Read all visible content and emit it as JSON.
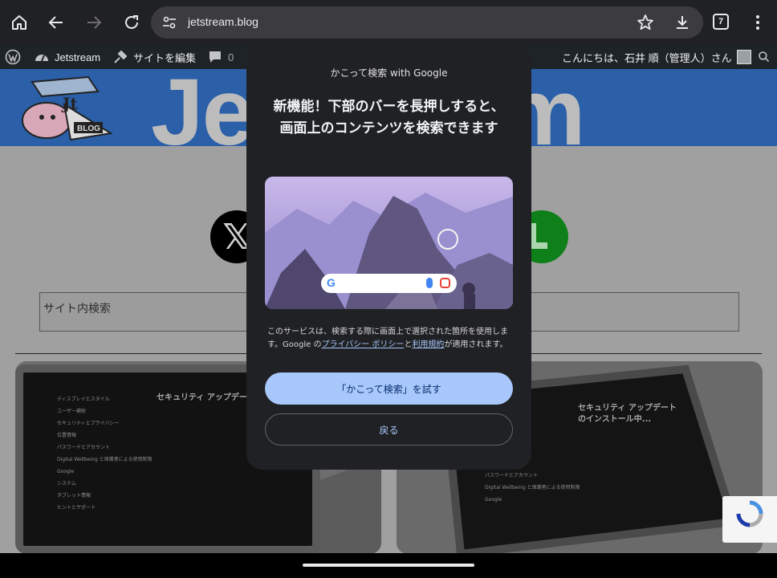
{
  "browser": {
    "url": "jetstream.blog",
    "tab_count": "7",
    "icons": [
      "home-icon",
      "back-icon",
      "forward-icon",
      "reload-icon",
      "site-settings-icon",
      "bookmark-star-icon",
      "download-icon",
      "tab-switcher-icon",
      "overflow-menu-icon"
    ]
  },
  "adminbar": {
    "site_name": "Jetstream",
    "edit_site": "サイトを編集",
    "comments_count": "0",
    "greeting": "こんにちは、石井 順（管理人）さん"
  },
  "page": {
    "banner_text": "Jetstream",
    "search_placeholder": "サイト内検索",
    "x_glyph": "𝕏"
  },
  "modal": {
    "header": "かこって検索 with Google",
    "title": "新機能！下部のバーを長押しすると、画面上のコンテンツを検索できます",
    "desc_prefix": "このサービスは、検索する際に画面上で選択された箇所を使用します。Google の",
    "privacy_link": "プライバシー ポリシー",
    "desc_middle": "と",
    "terms_link": "利用規約",
    "desc_suffix": "が適用されます。",
    "primary_button": "「かこって検索」を試す",
    "secondary_button": "戻る",
    "g_letter": "G"
  },
  "thumbs": {
    "left_heading": "セキュリティ アップデートのインストール中...",
    "left_menu": "ディスプレイとスタイル\nユーザー補助\nセキュリティとプライバシー\n位置情報\nパスワードとアカウント\nDigital Wellbeing と保護者による使用制限\nGoogle\nシステム\nタブレット情報\nヒントとサポート",
    "right_heading": "セキュリティ アップデートのインストール中...",
    "right_menu": "安全性と緊急情報\nパスワードとアカウント\nDigital Wellbeing と保護者による使用制限\nGoogle"
  },
  "colors": {
    "accent": "#a8c7fa",
    "modal_bg": "#202124",
    "adminbar_bg": "#1d2327",
    "banner_bg": "#2b5fa8"
  }
}
